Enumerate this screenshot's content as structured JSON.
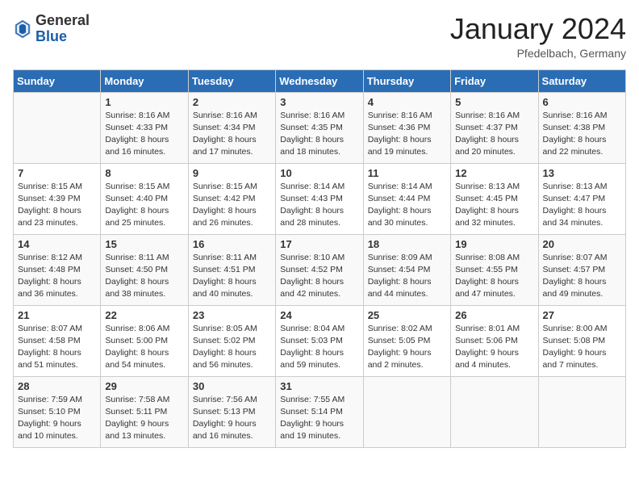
{
  "header": {
    "logo_general": "General",
    "logo_blue": "Blue",
    "month_title": "January 2024",
    "location": "Pfedelbach, Germany"
  },
  "days_of_week": [
    "Sunday",
    "Monday",
    "Tuesday",
    "Wednesday",
    "Thursday",
    "Friday",
    "Saturday"
  ],
  "weeks": [
    [
      {
        "day": "",
        "info": ""
      },
      {
        "day": "1",
        "info": "Sunrise: 8:16 AM\nSunset: 4:33 PM\nDaylight: 8 hours\nand 16 minutes."
      },
      {
        "day": "2",
        "info": "Sunrise: 8:16 AM\nSunset: 4:34 PM\nDaylight: 8 hours\nand 17 minutes."
      },
      {
        "day": "3",
        "info": "Sunrise: 8:16 AM\nSunset: 4:35 PM\nDaylight: 8 hours\nand 18 minutes."
      },
      {
        "day": "4",
        "info": "Sunrise: 8:16 AM\nSunset: 4:36 PM\nDaylight: 8 hours\nand 19 minutes."
      },
      {
        "day": "5",
        "info": "Sunrise: 8:16 AM\nSunset: 4:37 PM\nDaylight: 8 hours\nand 20 minutes."
      },
      {
        "day": "6",
        "info": "Sunrise: 8:16 AM\nSunset: 4:38 PM\nDaylight: 8 hours\nand 22 minutes."
      }
    ],
    [
      {
        "day": "7",
        "info": "Sunrise: 8:15 AM\nSunset: 4:39 PM\nDaylight: 8 hours\nand 23 minutes."
      },
      {
        "day": "8",
        "info": "Sunrise: 8:15 AM\nSunset: 4:40 PM\nDaylight: 8 hours\nand 25 minutes."
      },
      {
        "day": "9",
        "info": "Sunrise: 8:15 AM\nSunset: 4:42 PM\nDaylight: 8 hours\nand 26 minutes."
      },
      {
        "day": "10",
        "info": "Sunrise: 8:14 AM\nSunset: 4:43 PM\nDaylight: 8 hours\nand 28 minutes."
      },
      {
        "day": "11",
        "info": "Sunrise: 8:14 AM\nSunset: 4:44 PM\nDaylight: 8 hours\nand 30 minutes."
      },
      {
        "day": "12",
        "info": "Sunrise: 8:13 AM\nSunset: 4:45 PM\nDaylight: 8 hours\nand 32 minutes."
      },
      {
        "day": "13",
        "info": "Sunrise: 8:13 AM\nSunset: 4:47 PM\nDaylight: 8 hours\nand 34 minutes."
      }
    ],
    [
      {
        "day": "14",
        "info": "Sunrise: 8:12 AM\nSunset: 4:48 PM\nDaylight: 8 hours\nand 36 minutes."
      },
      {
        "day": "15",
        "info": "Sunrise: 8:11 AM\nSunset: 4:50 PM\nDaylight: 8 hours\nand 38 minutes."
      },
      {
        "day": "16",
        "info": "Sunrise: 8:11 AM\nSunset: 4:51 PM\nDaylight: 8 hours\nand 40 minutes."
      },
      {
        "day": "17",
        "info": "Sunrise: 8:10 AM\nSunset: 4:52 PM\nDaylight: 8 hours\nand 42 minutes."
      },
      {
        "day": "18",
        "info": "Sunrise: 8:09 AM\nSunset: 4:54 PM\nDaylight: 8 hours\nand 44 minutes."
      },
      {
        "day": "19",
        "info": "Sunrise: 8:08 AM\nSunset: 4:55 PM\nDaylight: 8 hours\nand 47 minutes."
      },
      {
        "day": "20",
        "info": "Sunrise: 8:07 AM\nSunset: 4:57 PM\nDaylight: 8 hours\nand 49 minutes."
      }
    ],
    [
      {
        "day": "21",
        "info": "Sunrise: 8:07 AM\nSunset: 4:58 PM\nDaylight: 8 hours\nand 51 minutes."
      },
      {
        "day": "22",
        "info": "Sunrise: 8:06 AM\nSunset: 5:00 PM\nDaylight: 8 hours\nand 54 minutes."
      },
      {
        "day": "23",
        "info": "Sunrise: 8:05 AM\nSunset: 5:02 PM\nDaylight: 8 hours\nand 56 minutes."
      },
      {
        "day": "24",
        "info": "Sunrise: 8:04 AM\nSunset: 5:03 PM\nDaylight: 8 hours\nand 59 minutes."
      },
      {
        "day": "25",
        "info": "Sunrise: 8:02 AM\nSunset: 5:05 PM\nDaylight: 9 hours\nand 2 minutes."
      },
      {
        "day": "26",
        "info": "Sunrise: 8:01 AM\nSunset: 5:06 PM\nDaylight: 9 hours\nand 4 minutes."
      },
      {
        "day": "27",
        "info": "Sunrise: 8:00 AM\nSunset: 5:08 PM\nDaylight: 9 hours\nand 7 minutes."
      }
    ],
    [
      {
        "day": "28",
        "info": "Sunrise: 7:59 AM\nSunset: 5:10 PM\nDaylight: 9 hours\nand 10 minutes."
      },
      {
        "day": "29",
        "info": "Sunrise: 7:58 AM\nSunset: 5:11 PM\nDaylight: 9 hours\nand 13 minutes."
      },
      {
        "day": "30",
        "info": "Sunrise: 7:56 AM\nSunset: 5:13 PM\nDaylight: 9 hours\nand 16 minutes."
      },
      {
        "day": "31",
        "info": "Sunrise: 7:55 AM\nSunset: 5:14 PM\nDaylight: 9 hours\nand 19 minutes."
      },
      {
        "day": "",
        "info": ""
      },
      {
        "day": "",
        "info": ""
      },
      {
        "day": "",
        "info": ""
      }
    ]
  ]
}
